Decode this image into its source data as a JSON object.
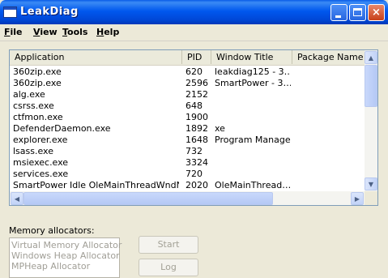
{
  "window": {
    "title": "LeakDiag",
    "controls": {
      "minimize": "minimize",
      "maximize": "maximize",
      "close": "×"
    }
  },
  "menu": [
    {
      "key": "F",
      "rest": "ile"
    },
    {
      "key": "V",
      "rest": "iew"
    },
    {
      "key": "T",
      "rest": "ools"
    },
    {
      "key": "H",
      "rest": "elp"
    }
  ],
  "process_list": {
    "columns": [
      "Application",
      "PID",
      "Window Title",
      "Package Name"
    ],
    "rows": [
      {
        "app": "360zip.exe",
        "pid": "620",
        "title": "leakdiag125 - 3…",
        "pkg": ""
      },
      {
        "app": "360zip.exe",
        "pid": "2596",
        "title": "SmartPower - 3…",
        "pkg": ""
      },
      {
        "app": "alg.exe",
        "pid": "2152",
        "title": "",
        "pkg": ""
      },
      {
        "app": "csrss.exe",
        "pid": "648",
        "title": "",
        "pkg": ""
      },
      {
        "app": "ctfmon.exe",
        "pid": "1900",
        "title": "",
        "pkg": ""
      },
      {
        "app": "DefenderDaemon.exe",
        "pid": "1892",
        "title": "xe",
        "pkg": ""
      },
      {
        "app": "explorer.exe",
        "pid": "1648",
        "title": "Program Manager",
        "pkg": ""
      },
      {
        "app": "lsass.exe",
        "pid": "732",
        "title": "",
        "pkg": ""
      },
      {
        "app": "msiexec.exe",
        "pid": "3324",
        "title": "",
        "pkg": ""
      },
      {
        "app": "services.exe",
        "pid": "720",
        "title": "",
        "pkg": ""
      },
      {
        "app": "SmartPower Idle OleMainThreadWndName",
        "pid": "2020",
        "title": "OleMainThread…",
        "pkg": ""
      }
    ]
  },
  "memory_allocators": {
    "label": "Memory allocators:",
    "items": [
      "Virtual Memory Allocator",
      "Windows Heap Allocator",
      "MPHeap Allocator"
    ]
  },
  "buttons": {
    "start": "Start",
    "log": "Log"
  },
  "colors": {
    "titlebar": "#0058ee",
    "close_button": "#c8401a",
    "window_bg": "#ece9d8"
  }
}
